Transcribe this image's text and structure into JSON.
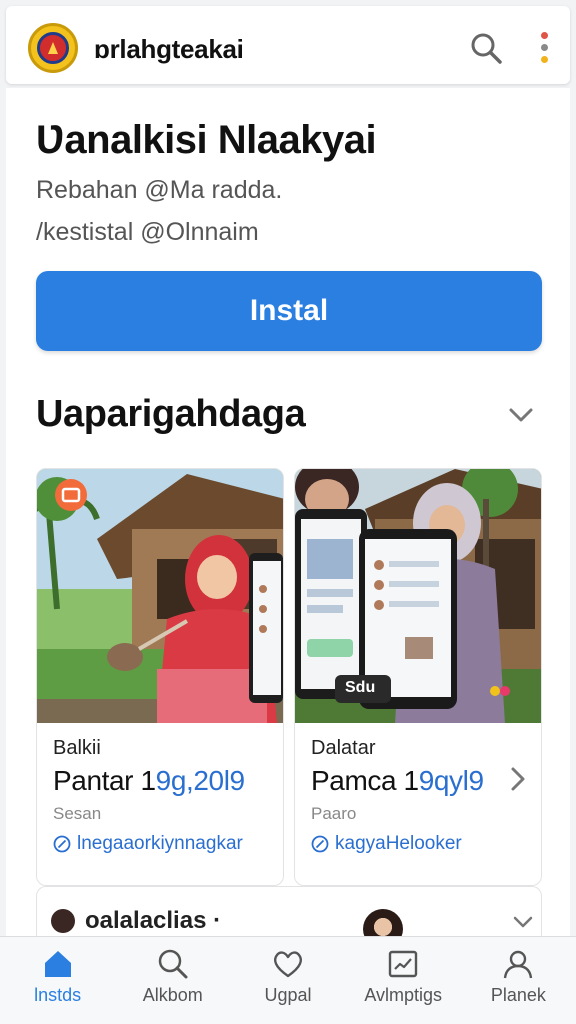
{
  "header": {
    "app_name": "ɒrlahgteakai",
    "logo_icon": "crest-logo-icon",
    "search_icon": "search-icon",
    "menu_icon": "kebab-menu-icon"
  },
  "app": {
    "title": "Ʋanalkisi Nlaakyai",
    "subtitle_1": "Rebahan @Ma radda.",
    "subtitle_2": "/kestistal @Olnnaim",
    "install_label": "Instal"
  },
  "section": {
    "title": "Uaparigahdaga",
    "chevron_icon": "chevron-down-icon"
  },
  "tiles": [
    {
      "category": "Balkii",
      "price_prefix": "Pantar 1",
      "price_highlight": "9g,20l9",
      "meta": "Sesan",
      "link_icon": "compass-icon",
      "link": "lnegaaorkiynnagkar",
      "badge_icon": "camera-badge-icon"
    },
    {
      "category": "Dalatar",
      "price_prefix": "Pamca 1",
      "price_highlight": "9qyl9",
      "meta": "Paaro",
      "link_icon": "compass-icon",
      "link": "kagyaHelooker",
      "chevron_icon": "chevron-right-icon",
      "photo_label": "Sdu"
    }
  ],
  "post": {
    "name": "oalalaclias ·",
    "chevron_icon": "chevron-down-icon"
  },
  "nav": [
    {
      "label": "lnstds",
      "icon": "home-icon",
      "active": true
    },
    {
      "label": "Alkbom",
      "icon": "search-icon",
      "active": false
    },
    {
      "label": "Ugpal",
      "icon": "heart-icon",
      "active": false
    },
    {
      "label": "Avlmptigs",
      "icon": "chart-icon",
      "active": false
    },
    {
      "label": "Planek",
      "icon": "profile-icon",
      "active": false
    }
  ],
  "colors": {
    "accent": "#2a7fe0",
    "link": "#2a6fd0",
    "logo_gold": "#f4c21c",
    "logo_red": "#d12d2d"
  }
}
